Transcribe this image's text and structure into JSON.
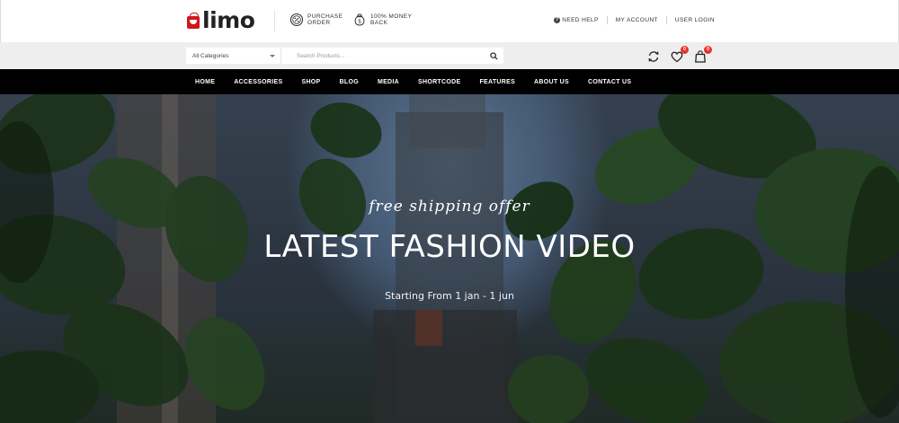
{
  "brand": {
    "name": "limo",
    "accent": "#d0161c"
  },
  "header": {
    "features": [
      {
        "icon": "discount-badge-icon",
        "line1": "PURCHASE",
        "line2": "ORDER"
      },
      {
        "icon": "money-bag-icon",
        "line1": "100% MONEY",
        "line2": "BACK"
      }
    ],
    "links": [
      {
        "icon": "help-circle-icon",
        "label": "NEED HELP"
      },
      {
        "label": "MY ACCOUNT"
      },
      {
        "label": "USER LOGIN"
      }
    ]
  },
  "search": {
    "category": "All Categories",
    "placeholder": "Search Products...",
    "button_icon": "search-icon"
  },
  "actions": {
    "compare_icon": "refresh-icon",
    "wishlist_icon": "heart-icon",
    "wishlist_count": "0",
    "cart_icon": "shopping-bag-icon",
    "cart_count": "0",
    "badge_color": "#e8322c"
  },
  "nav": {
    "items": [
      "HOME",
      "ACCESSORIES",
      "SHOP",
      "BLOG",
      "MEDIA",
      "SHORTCODE",
      "FEATURES",
      "ABOUT US",
      "CONTACT US"
    ]
  },
  "hero": {
    "tagline": "free shipping offer",
    "title": "LATEST FASHION VIDEO",
    "subtitle": "Starting From 1 jan - 1 jun"
  }
}
